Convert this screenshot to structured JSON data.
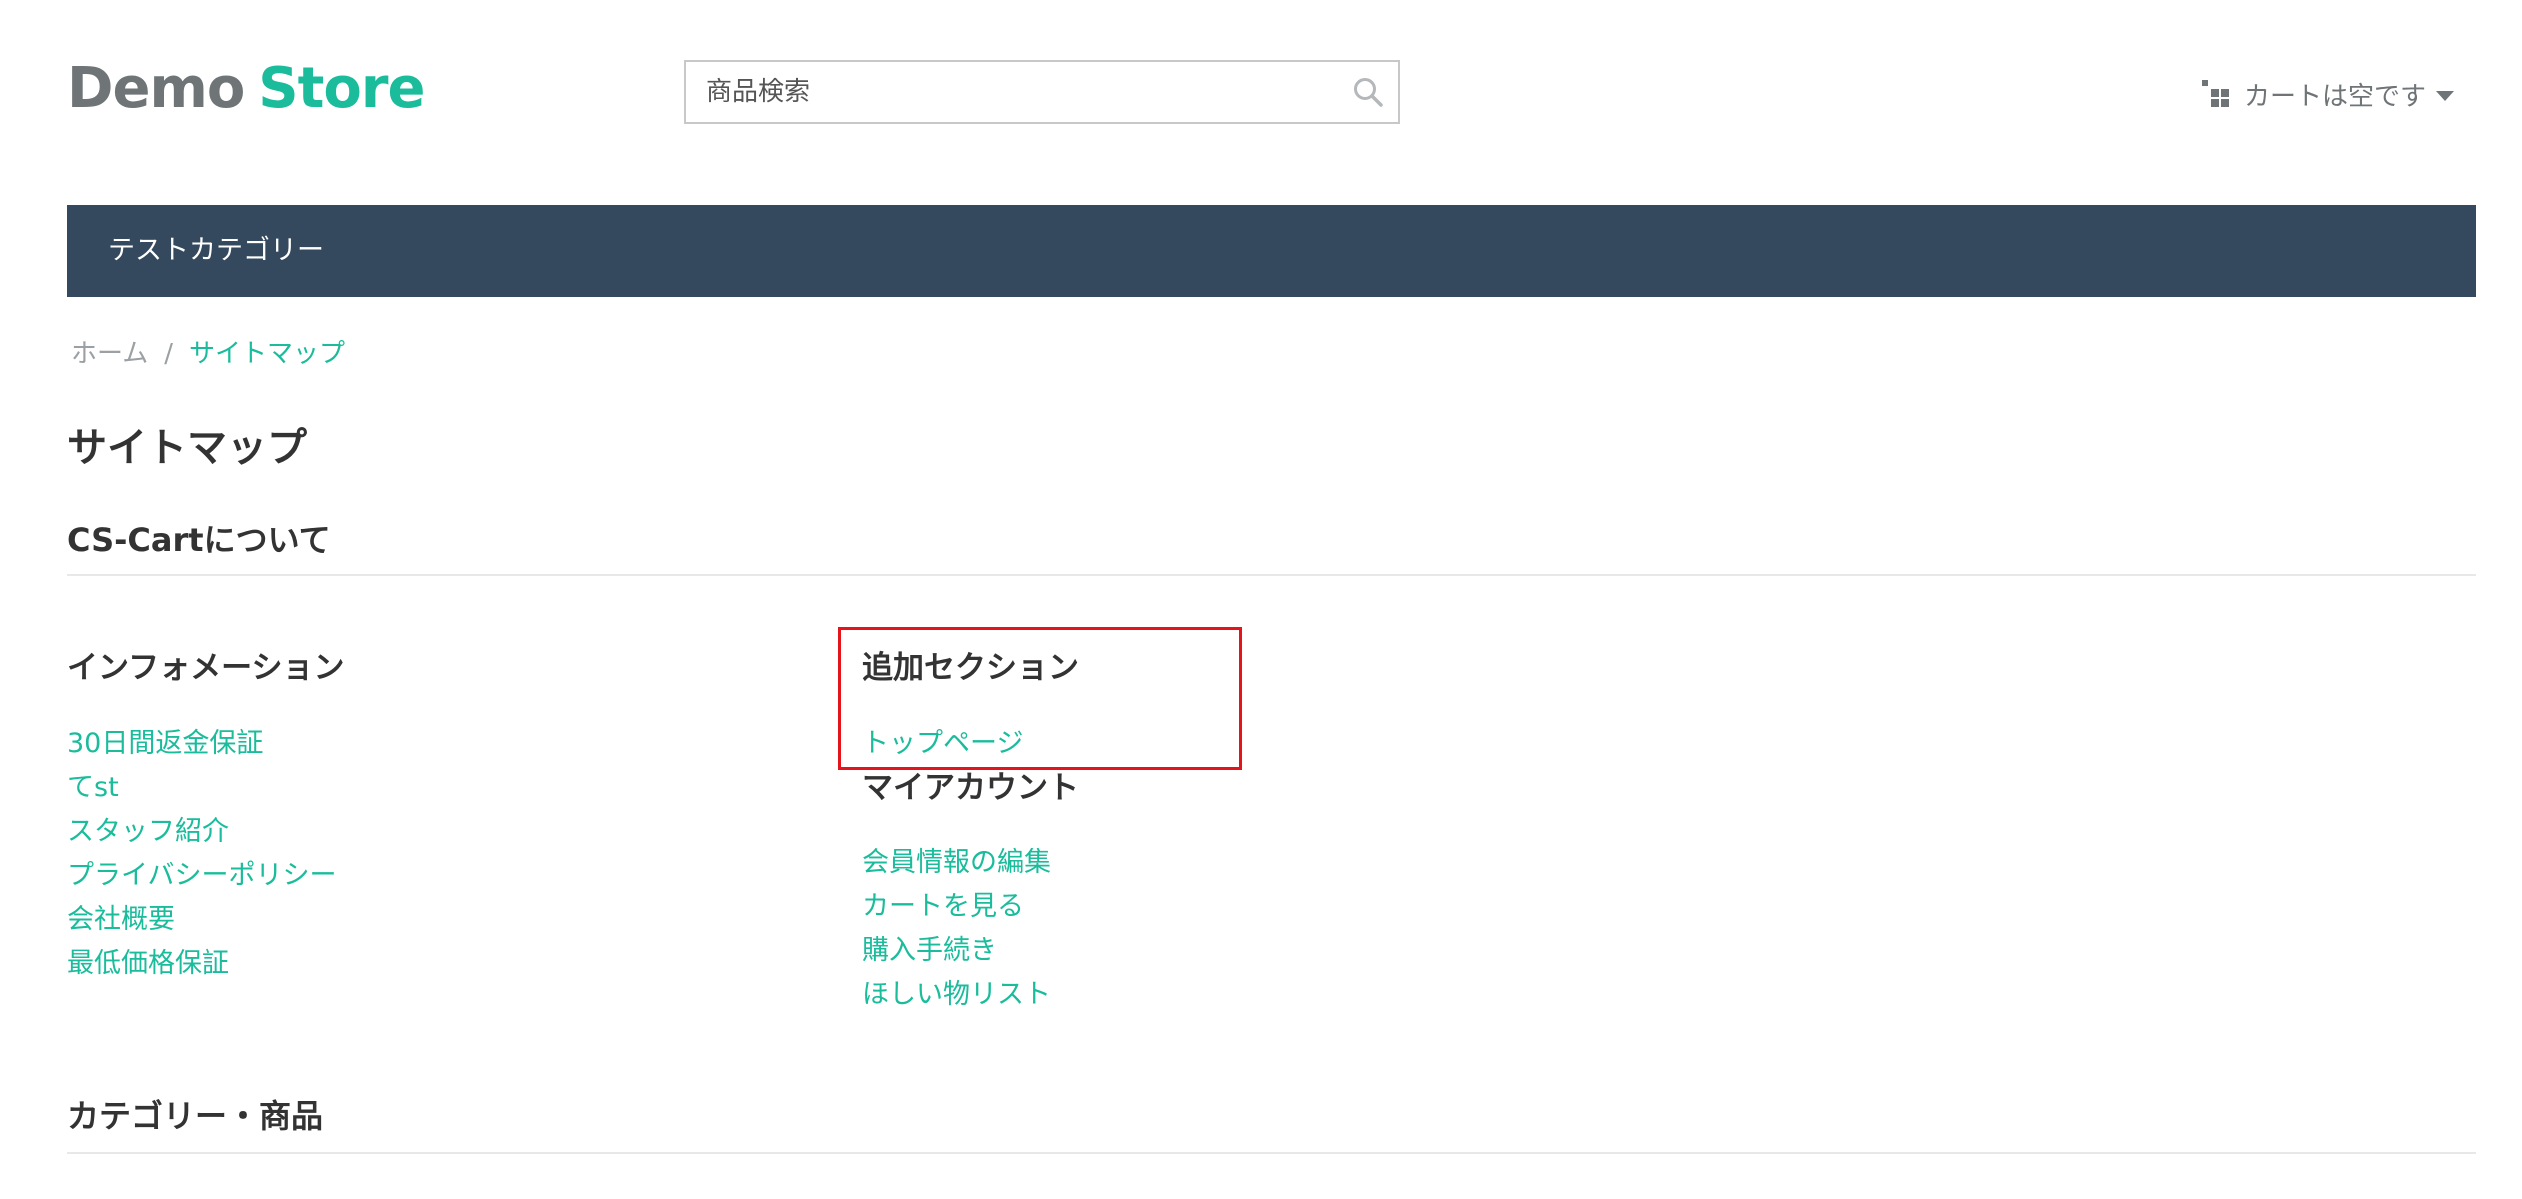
{
  "header": {
    "logo_word1": "Demo",
    "logo_word2": "Store",
    "search_placeholder": "商品検索",
    "search_icon": "search-icon",
    "cart_icon": "cart-grid-icon",
    "cart_label": "カートは空です",
    "cart_caret_icon": "caret-down-icon"
  },
  "nav": {
    "items": [
      "テストカテゴリー"
    ]
  },
  "breadcrumb": {
    "home": "ホーム",
    "separator": "/",
    "current": "サイトマップ"
  },
  "page": {
    "title": "サイトマップ"
  },
  "sections": {
    "about": "CS-Cartについて",
    "categories": "カテゴリー・商品"
  },
  "information": {
    "heading": "インフォメーション",
    "links": [
      "30日間返金保証",
      "てst",
      "スタッフ紹介",
      "プライバシーポリシー",
      "会社概要",
      "最低価格保証"
    ]
  },
  "additional": {
    "heading": "追加セクション",
    "links": [
      "トップページ"
    ]
  },
  "account": {
    "heading": "マイアカウント",
    "links": [
      "会員情報の編集",
      "カートを見る",
      "購入手続き",
      "ほしい物リスト"
    ]
  },
  "colors": {
    "accent": "#1abc9c",
    "nav_bg": "#34495e",
    "highlight": "#e5141b",
    "logo_gray": "#6f7477"
  }
}
